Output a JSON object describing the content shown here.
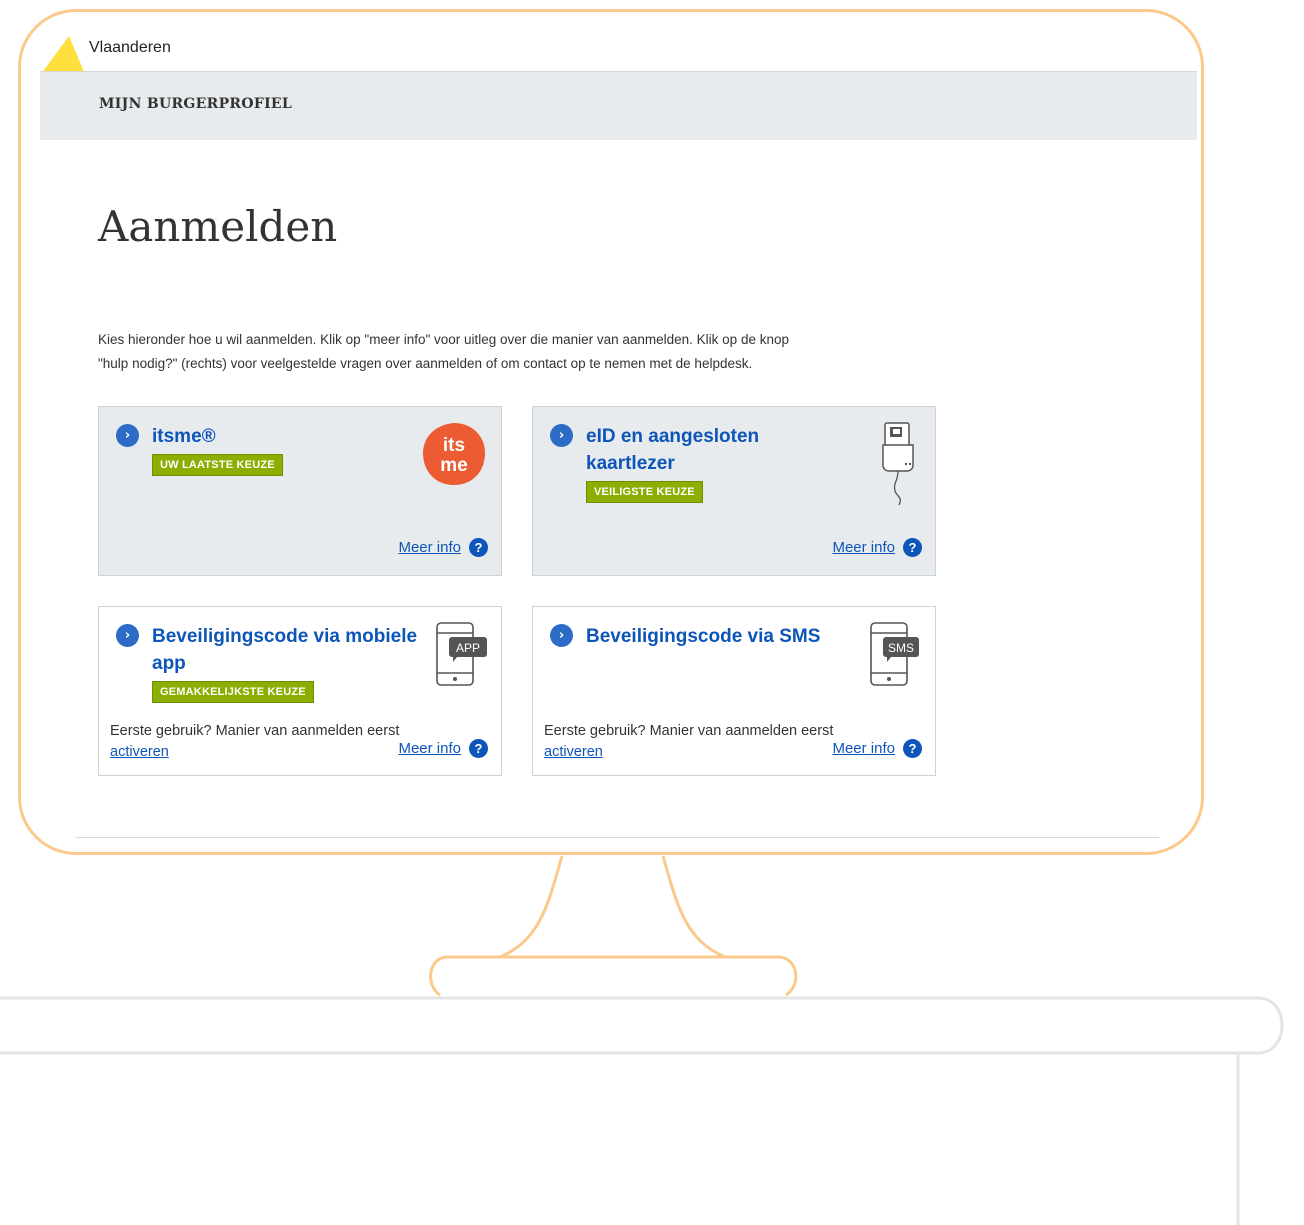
{
  "header": {
    "brand": "Vlaanderen",
    "profile": "MIJN BURGERPROFIEL"
  },
  "page": {
    "title": "Aanmelden",
    "intro_line1": "Kies hieronder hoe u wil aanmelden. Klik op \"meer info\" voor uitleg over die manier van aanmelden. Klik op de knop",
    "intro_line2": "\"hulp nodig?\" (rechts) voor veelgestelde vragen over aanmelden of om contact op te nemen met de helpdesk."
  },
  "cards": [
    {
      "title": "itsme®",
      "badge": "UW LAATSTE KEUZE",
      "more": "Meer info",
      "icon": "itsme-logo"
    },
    {
      "title": "eID en aangesloten kaartlezer",
      "badge": "VEILIGSTE KEUZE",
      "more": "Meer info",
      "icon": "card-reader-icon"
    },
    {
      "title": "Beveiligingscode via mobiele app",
      "badge": "GEMAKKELIJKSTE KEUZE",
      "first_use_text": "Eerste gebruik? Manier van aanmelden eerst",
      "first_use_link": "activeren",
      "more": "Meer info",
      "icon": "phone-app-icon",
      "icon_label": "APP"
    },
    {
      "title": "Beveiligingscode via SMS",
      "first_use_text": "Eerste gebruik? Manier van aanmelden eerst",
      "first_use_link": "activeren",
      "more": "Meer info",
      "icon": "phone-sms-icon",
      "icon_label": "SMS"
    }
  ],
  "logos": {
    "itsme_top": "its",
    "itsme_bottom": "me"
  },
  "colors": {
    "frame": "#fbc98b",
    "link": "#0d55b9",
    "badge": "#8bae00",
    "itsme": "#ec5b32",
    "flag": "#fedf3c"
  }
}
